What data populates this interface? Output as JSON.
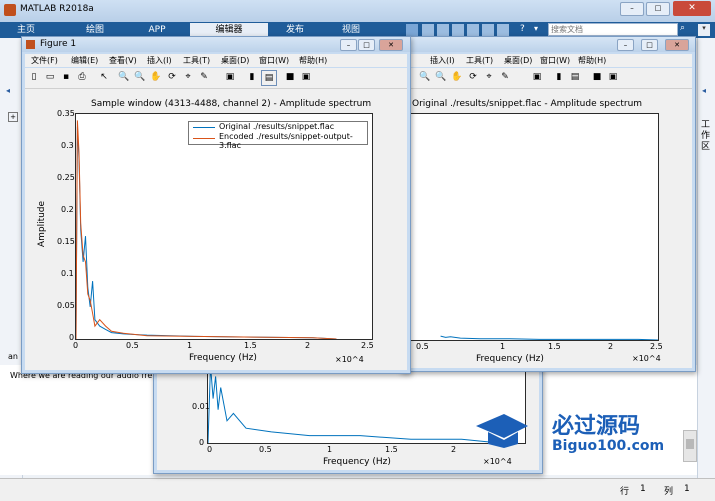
{
  "app": {
    "title": "MATLAB R2018a",
    "ribbon_tabs": [
      "主页",
      "绘图",
      "APP",
      "编辑器",
      "发布",
      "视图"
    ],
    "search_placeholder": "搜索文档",
    "side_label": "工作区",
    "editor_text": "Where we are reading our audio fre",
    "command_prefix": "an",
    "status_line_label": "行",
    "status_line_value": "1",
    "status_col_label": "列",
    "status_col_value": "1"
  },
  "figure1": {
    "title": "Figure 1",
    "menu": [
      "文件(F)",
      "编辑(E)",
      "查看(V)",
      "插入(I)",
      "工具(T)",
      "桌面(D)",
      "窗口(W)",
      "帮助(H)"
    ]
  },
  "figure2": {
    "menu": [
      "插入(I)",
      "工具(T)",
      "桌面(D)",
      "窗口(W)",
      "帮助(H)"
    ]
  },
  "watermark": {
    "title": "必过源码",
    "url": "Biguo100.com"
  },
  "chart_data": [
    {
      "type": "line",
      "title": "Sample window (4313-4488, channel 2) - Amplitude spectrum",
      "xlabel": "Frequency (Hz)",
      "ylabel": "Amplitude",
      "x_multiplier": "×10^4",
      "xlim": [
        0,
        2.5
      ],
      "ylim": [
        0,
        0.35
      ],
      "x_ticks": [
        "0",
        "0.5",
        "1",
        "1.5",
        "2",
        "2.5"
      ],
      "y_ticks": [
        "0",
        "0.05",
        "0.1",
        "0.15",
        "0.2",
        "0.25",
        "0.3",
        "0.35"
      ],
      "legend": "top-right",
      "series": [
        {
          "name": "Original ./results/snippet.flac",
          "color": "#0072bd",
          "x": [
            0,
            0.012,
            0.025,
            0.04,
            0.06,
            0.08,
            0.1,
            0.12,
            0.14,
            0.16,
            0.2,
            0.25,
            0.3,
            0.4,
            0.6,
            1.0,
            1.5,
            2.0,
            2.2
          ],
          "y": [
            0.0,
            0.33,
            0.28,
            0.17,
            0.12,
            0.16,
            0.08,
            0.05,
            0.09,
            0.03,
            0.02,
            0.015,
            0.01,
            0.008,
            0.006,
            0.004,
            0.003,
            0.002,
            0.0
          ]
        },
        {
          "name": "Encoded ./results/snippet-output-3.flac",
          "color": "#d95319",
          "x": [
            0,
            0.012,
            0.025,
            0.04,
            0.06,
            0.08,
            0.1,
            0.12,
            0.14,
            0.16,
            0.2,
            0.25,
            0.3,
            0.4,
            0.6,
            1.0,
            1.5,
            2.0,
            2.2
          ],
          "y": [
            0.0,
            0.34,
            0.29,
            0.18,
            0.13,
            0.12,
            0.07,
            0.06,
            0.04,
            0.02,
            0.03,
            0.02,
            0.012,
            0.009,
            0.005,
            0.004,
            0.003,
            0.002,
            0.0
          ]
        }
      ]
    },
    {
      "type": "line",
      "title": "Original ./results/snippet.flac - Amplitude spectrum",
      "xlabel": "Frequency (Hz)",
      "x_multiplier": "×10^4",
      "xlim": [
        0,
        2.5
      ],
      "x_ticks": [
        "0.5",
        "1",
        "1.5",
        "2",
        "2.5"
      ],
      "series": [
        {
          "color": "#0072bd",
          "x": [
            0.3,
            0.35,
            0.4,
            0.5,
            0.7,
            1.0,
            1.3,
            1.6,
            2.0,
            2.3,
            2.5
          ],
          "y": [
            0.006,
            0.004,
            0.005,
            0.003,
            0.002,
            0.002,
            0.001,
            0.001,
            0.001,
            0.001,
            0.0
          ]
        }
      ]
    },
    {
      "type": "line",
      "xlabel": "Frequency (Hz)",
      "x_multiplier": "×10^4",
      "xlim": [
        0,
        2.5
      ],
      "ylim": [
        0,
        0.02
      ],
      "x_ticks": [
        "0",
        "0.5",
        "1",
        "1.5",
        "2"
      ],
      "y_ticks": [
        "0",
        "0.01",
        "0.02"
      ],
      "series": [
        {
          "color": "#0072bd",
          "x": [
            0.0,
            0.02,
            0.04,
            0.06,
            0.08,
            0.1,
            0.15,
            0.2,
            0.3,
            0.5,
            0.8,
            1.2,
            1.6,
            2.0,
            2.3
          ],
          "y": [
            0.0,
            0.021,
            0.012,
            0.018,
            0.009,
            0.015,
            0.006,
            0.008,
            0.004,
            0.003,
            0.002,
            0.002,
            0.001,
            0.001,
            0.0
          ]
        }
      ]
    }
  ]
}
